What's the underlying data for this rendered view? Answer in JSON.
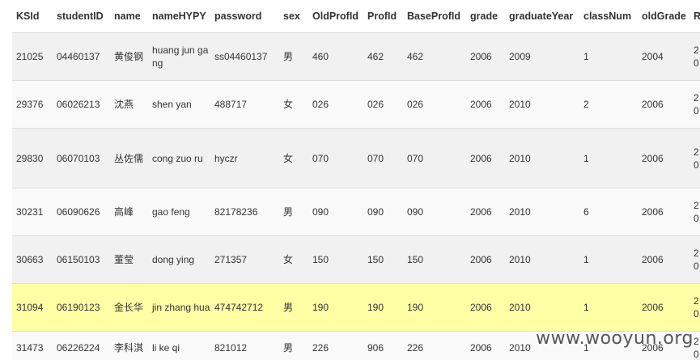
{
  "table": {
    "columns": [
      "KSId",
      "studentID",
      "name",
      "nameHYPY",
      "password",
      "sex",
      "OldProfId",
      "ProfId",
      "BaseProfId",
      "grade",
      "graduateYear",
      "classNum",
      "oldGrade",
      "R"
    ],
    "rows": [
      {
        "cells": [
          "21025",
          "04460137",
          "黄俊钢",
          "huang jun gang",
          "ss04460137",
          "男",
          "460",
          "462",
          "462",
          "2006",
          "2009",
          "1",
          "2004",
          "2\n0"
        ]
      },
      {
        "cells": [
          "29376",
          "06026213",
          "沈燕",
          "shen yan",
          "488717",
          "女",
          "026",
          "026",
          "026",
          "2006",
          "2010",
          "2",
          "2006",
          "2\n0"
        ]
      },
      {
        "cells": [
          "29830",
          "06070103",
          "丛佐儒",
          "cong zuo ru",
          "hyczr",
          "女",
          "070",
          "070",
          "070",
          "2006",
          "2010",
          "1",
          "2006",
          "2\n0"
        ]
      },
      {
        "cells": [
          "30231",
          "06090626",
          "高峰",
          "gao feng",
          "82178236",
          "男",
          "090",
          "090",
          "090",
          "2006",
          "2010",
          "6",
          "2006",
          "2\n0"
        ]
      },
      {
        "cells": [
          "30663",
          "06150103",
          "董莹",
          "dong ying",
          "271357",
          "女",
          "150",
          "150",
          "150",
          "2006",
          "2010",
          "1",
          "2006",
          "2\n0"
        ]
      },
      {
        "cells": [
          "31094",
          "06190123",
          "金长华",
          "jin zhang hua",
          "474742712",
          "男",
          "190",
          "190",
          "190",
          "2006",
          "2010",
          "1",
          "2006",
          "2\n0"
        ]
      },
      {
        "cells": [
          "31473",
          "06226224",
          "李科淇",
          "li ke qi",
          "821012",
          "男",
          "226",
          "906",
          "226",
          "2006",
          "2010",
          "1",
          "2006",
          "2\n0"
        ]
      }
    ]
  },
  "watermark": "www.wooyun.org"
}
